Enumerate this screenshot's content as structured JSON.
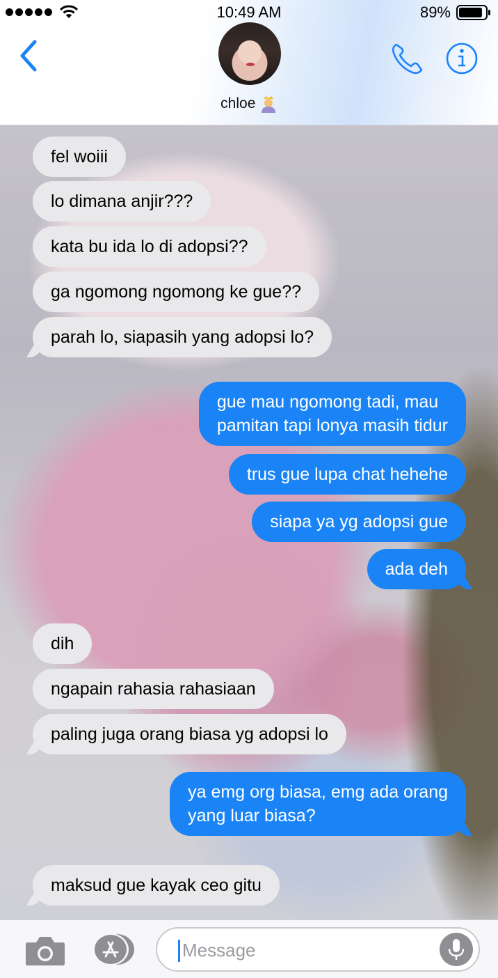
{
  "status_bar": {
    "time": "10:49 AM",
    "battery": "89%",
    "battery_level": 0.89
  },
  "header": {
    "contact_name": "chloe",
    "contact_emoji": "person-with-crown-emoji",
    "icons": [
      "back-chevron-icon",
      "phone-icon",
      "info-icon"
    ]
  },
  "messages": [
    {
      "dir": "in",
      "text": "fel woiii"
    },
    {
      "dir": "in",
      "text": "lo dimana anjir???"
    },
    {
      "dir": "in",
      "text": "kata bu ida lo di adopsi??"
    },
    {
      "dir": "in",
      "text": "ga ngomong ngomong ke gue??"
    },
    {
      "dir": "in",
      "text": "parah lo, siapasih yang adopsi lo?"
    },
    {
      "dir": "out",
      "lines": [
        "gue mau ngomong tadi, mau",
        "pamitan tapi lonya masih tidur"
      ]
    },
    {
      "dir": "out",
      "text": "trus gue lupa chat hehehe"
    },
    {
      "dir": "out",
      "text": "siapa ya yg adopsi gue"
    },
    {
      "dir": "out",
      "text": "ada deh"
    },
    {
      "dir": "in",
      "text": "dih"
    },
    {
      "dir": "in",
      "text": "ngapain rahasia rahasiaan"
    },
    {
      "dir": "in",
      "text": "paling juga orang biasa yg adopsi lo"
    },
    {
      "dir": "out",
      "lines": [
        "ya emg org biasa, emg ada orang",
        "yang luar biasa?"
      ]
    },
    {
      "dir": "in",
      "text": "maksud gue kayak ceo gitu"
    }
  ],
  "input_bar": {
    "placeholder": "Message",
    "value": "",
    "icons": [
      "camera-icon",
      "app-store-icon",
      "microphone-icon"
    ]
  },
  "colors": {
    "accent": "#1a84f7",
    "incoming_bubble": "#e9e9eb",
    "incoming_text": "#000000",
    "outgoing_text": "#ffffff"
  }
}
